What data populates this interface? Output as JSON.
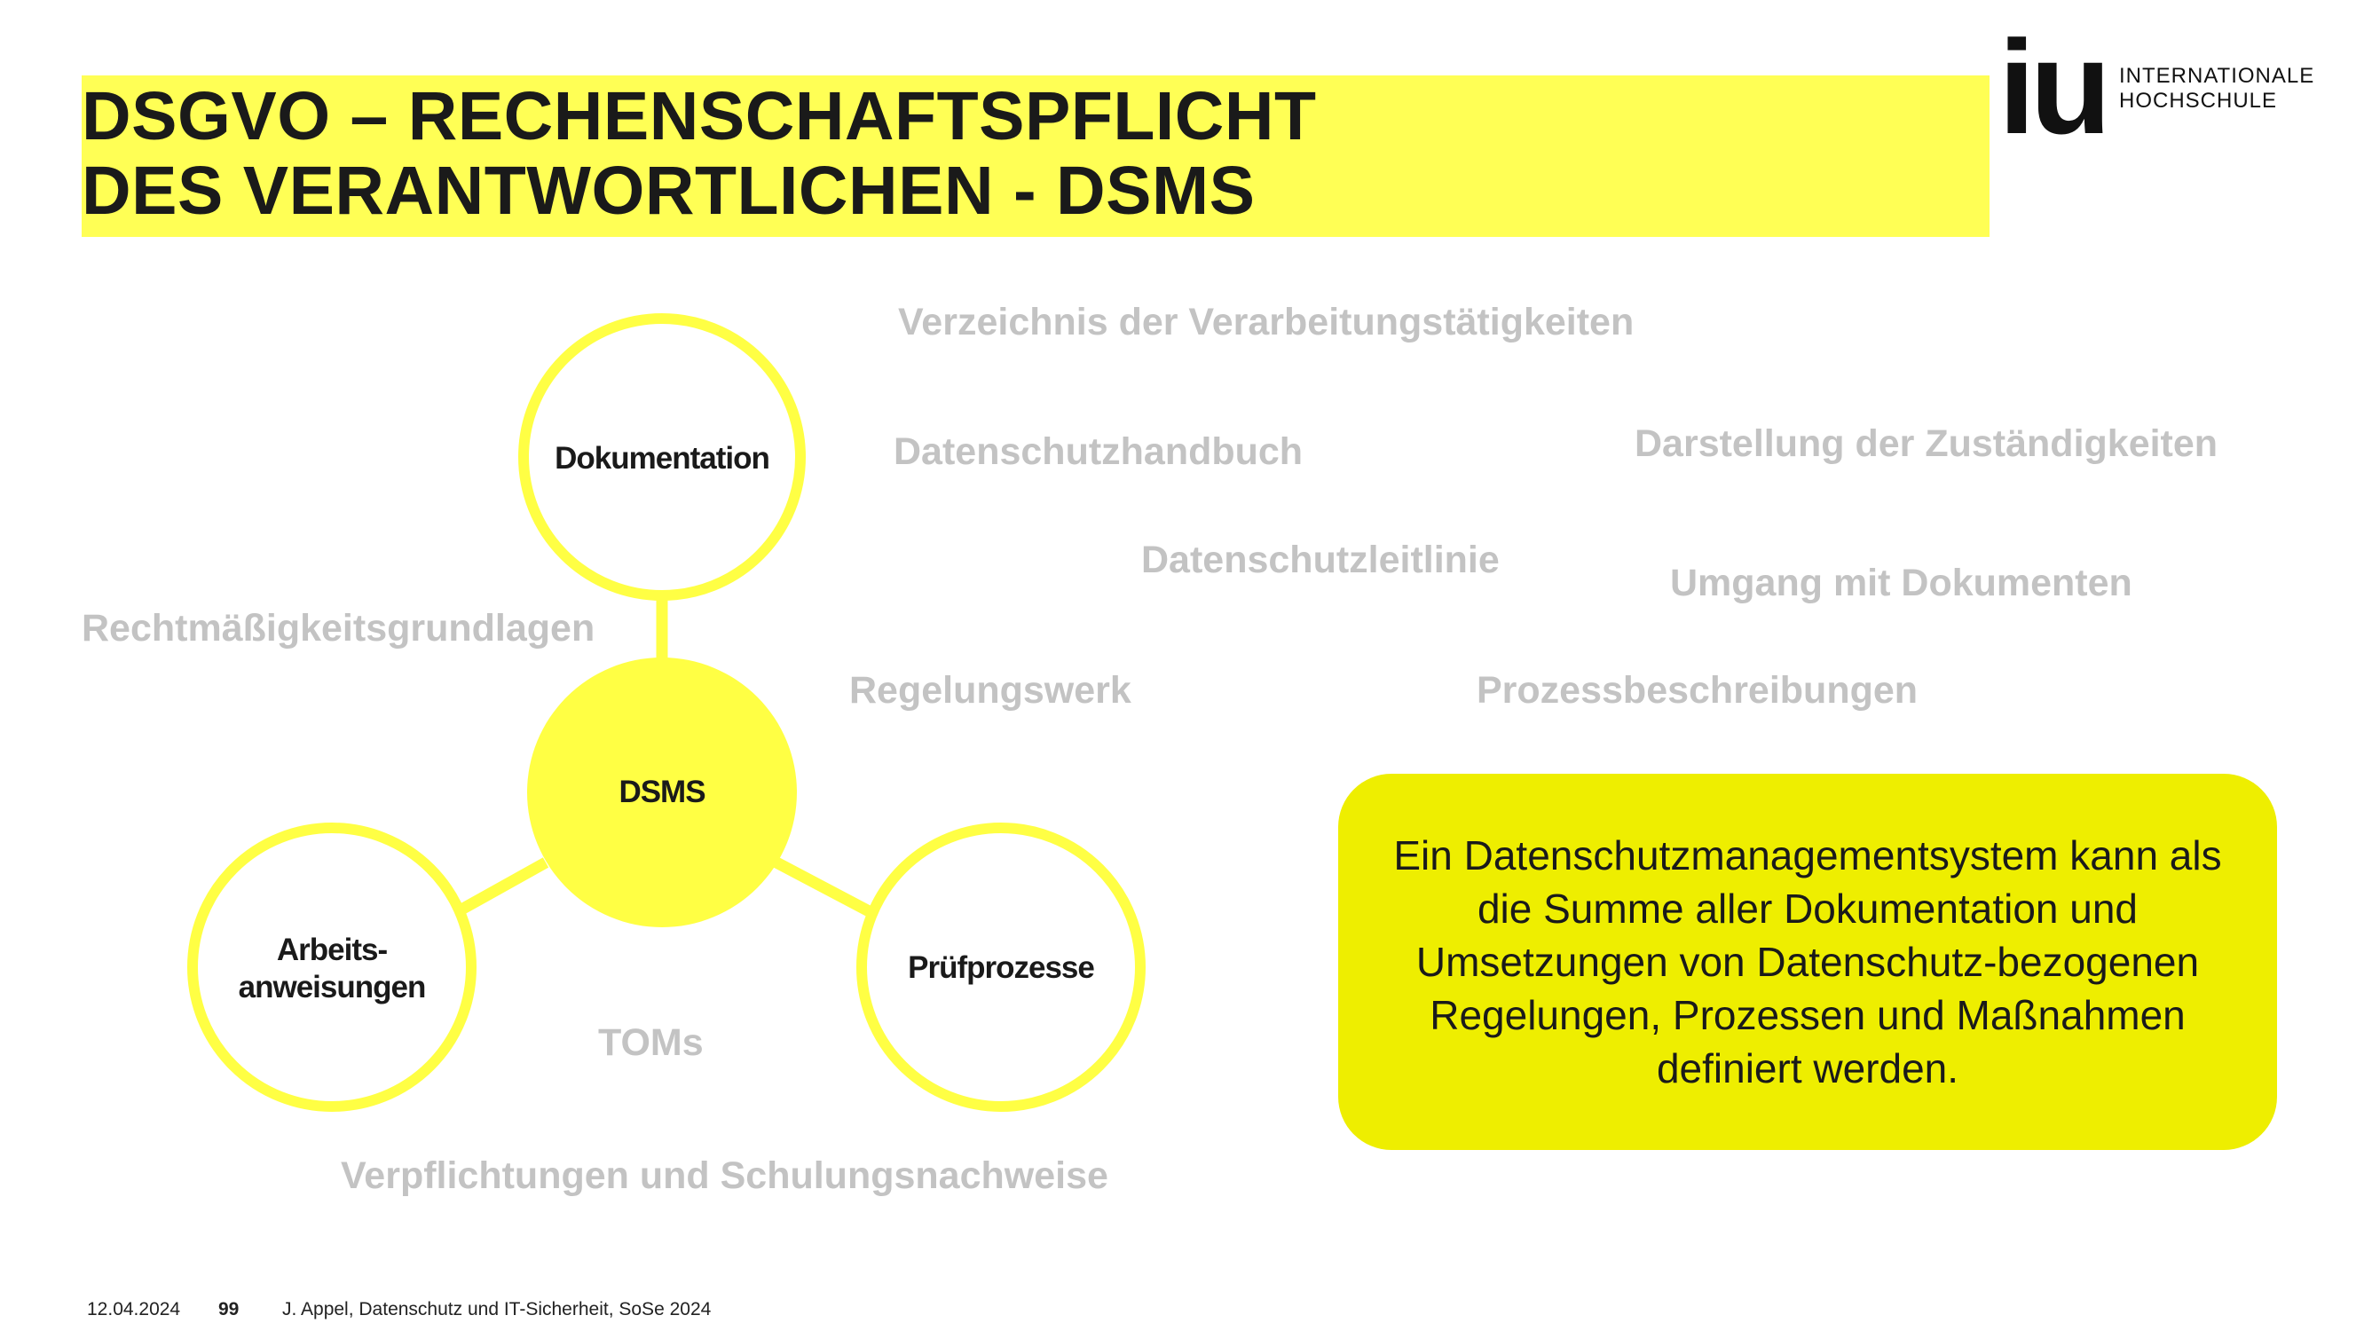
{
  "title": {
    "line1": "DSGVO –  RECHENSCHAFTSPFLICHT",
    "line2": "DES VERANTWORTLICHEN - DSMS"
  },
  "logo": {
    "mark": "iu",
    "line1": "INTERNATIONALE",
    "line2": "HOCHSCHULE"
  },
  "diagram": {
    "center": "DSMS",
    "top": "Dokumentation",
    "left_line1": "Arbeits-",
    "left_line2": "anweisungen",
    "right": "Prüfprozesse"
  },
  "terms": {
    "verzeichnis": "Verzeichnis der Verarbeitungstätigkeiten",
    "handbuch": "Datenschutzhandbuch",
    "zustaendigkeiten": "Darstellung der Zuständigkeiten",
    "leitlinie": "Datenschutzleitlinie",
    "umgang": "Umgang mit Dokumenten",
    "rechtmaessigkeit": "Rechtmäßigkeitsgrundlagen",
    "regelungswerk": "Regelungswerk",
    "prozess": "Prozessbeschreibungen",
    "toms": "TOMs",
    "verpflichtungen": "Verpflichtungen und Schulungsnachweise"
  },
  "info_box": {
    "text": "Ein Datenschutzmanagementsystem kann als die Summe aller Dokumentation und Umsetzungen von Datenschutz-bezogenen Regelungen, Prozessen und Maßnahmen definiert werden."
  },
  "footer": {
    "date": "12.04.2024",
    "page": "99",
    "source": "J. Appel, Datenschutz und IT-Sicherheit, SoSe 2024"
  },
  "colors": {
    "title_highlight": "#ffff55",
    "circle_yellow": "#ffff44",
    "info_box": "#eeee00",
    "gray_text": "#c3c3c3"
  }
}
